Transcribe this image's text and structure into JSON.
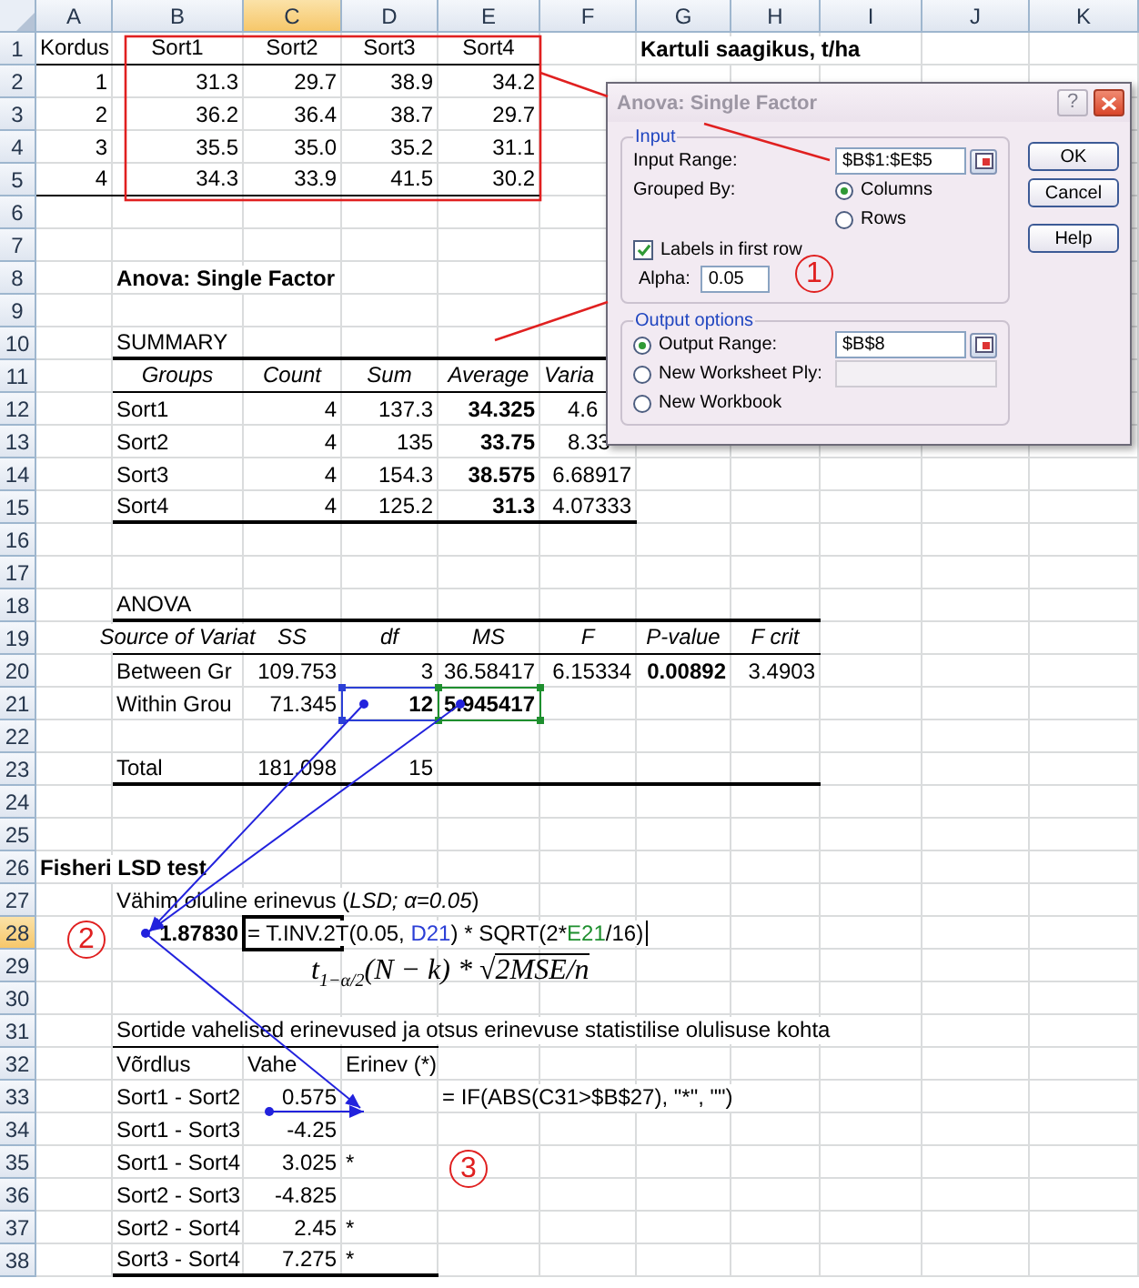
{
  "columns": [
    {
      "label": "A",
      "selected": false
    },
    {
      "label": "B",
      "selected": false
    },
    {
      "label": "C",
      "selected": true
    },
    {
      "label": "D",
      "selected": false
    },
    {
      "label": "E",
      "selected": false
    },
    {
      "label": "F",
      "selected": false
    },
    {
      "label": "G",
      "selected": false
    },
    {
      "label": "H",
      "selected": false
    },
    {
      "label": "I",
      "selected": false
    },
    {
      "label": "J",
      "selected": false
    },
    {
      "label": "K",
      "selected": false
    }
  ],
  "rows": [
    {
      "label": "1",
      "selected": false,
      "cells": {
        "A": {
          "kind": "label",
          "text": "Kordus"
        },
        "B": {
          "kind": "heading_plain",
          "text": "Sort1"
        },
        "C": {
          "kind": "heading_plain",
          "text": "Sort2"
        },
        "D": {
          "kind": "heading_plain",
          "text": "Sort3"
        },
        "E": {
          "kind": "heading_plain",
          "text": "Sort4"
        },
        "G": {
          "kind": "strong",
          "text": "Kartuli saagikus, t/ha"
        }
      }
    },
    {
      "label": "2",
      "selected": false,
      "cells": {
        "A": {
          "kind": "number",
          "text": "1"
        },
        "B": {
          "kind": "number",
          "text": "31.3"
        },
        "C": {
          "kind": "number",
          "text": "29.7"
        },
        "D": {
          "kind": "number",
          "text": "38.9"
        },
        "E": {
          "kind": "number",
          "text": "34.2"
        }
      }
    },
    {
      "label": "3",
      "selected": false,
      "cells": {
        "A": {
          "kind": "number",
          "text": "2"
        },
        "B": {
          "kind": "number",
          "text": "36.2"
        },
        "C": {
          "kind": "number",
          "text": "36.4"
        },
        "D": {
          "kind": "number",
          "text": "38.7"
        },
        "E": {
          "kind": "number",
          "text": "29.7"
        }
      }
    },
    {
      "label": "4",
      "selected": false,
      "cells": {
        "A": {
          "kind": "number",
          "text": "3"
        },
        "B": {
          "kind": "number",
          "text": "35.5"
        },
        "C": {
          "kind": "number",
          "text": "35.0"
        },
        "D": {
          "kind": "number",
          "text": "35.2"
        },
        "E": {
          "kind": "number",
          "text": "31.1"
        }
      }
    },
    {
      "label": "5",
      "selected": false,
      "cells": {
        "A": {
          "kind": "number",
          "text": "4"
        },
        "B": {
          "kind": "number",
          "text": "34.3"
        },
        "C": {
          "kind": "number",
          "text": "33.9"
        },
        "D": {
          "kind": "number",
          "text": "41.5"
        },
        "E": {
          "kind": "number",
          "text": "30.2"
        }
      }
    },
    {
      "label": "6",
      "selected": false
    },
    {
      "label": "7",
      "selected": false
    },
    {
      "label": "8",
      "selected": false,
      "cells": {
        "B": {
          "kind": "strong",
          "text": "Anova: Single Factor"
        }
      }
    },
    {
      "label": "9",
      "selected": false
    },
    {
      "label": "10",
      "selected": false,
      "cells": {
        "B": {
          "kind": "label",
          "text": "SUMMARY"
        }
      }
    },
    {
      "label": "11",
      "selected": false,
      "cells": {
        "B": {
          "kind": "heading",
          "text": "Groups"
        },
        "C": {
          "kind": "heading",
          "text": "Count"
        },
        "D": {
          "kind": "heading",
          "text": "Sum"
        },
        "E": {
          "kind": "heading",
          "text": "Average"
        },
        "F": {
          "kind": "cut_heading",
          "text": "Varia"
        }
      }
    },
    {
      "label": "12",
      "selected": false,
      "cells": {
        "B": {
          "kind": "label",
          "text": "Sort1"
        },
        "C": {
          "kind": "number",
          "text": "4"
        },
        "D": {
          "kind": "number",
          "text": "137.3"
        },
        "E": {
          "kind": "strong_number",
          "text": "34.325"
        },
        "F": {
          "kind": "cut_number",
          "text": "4.6"
        }
      }
    },
    {
      "label": "13",
      "selected": false,
      "cells": {
        "B": {
          "kind": "label",
          "text": "Sort2"
        },
        "C": {
          "kind": "number",
          "text": "4"
        },
        "D": {
          "kind": "number",
          "text": "135"
        },
        "E": {
          "kind": "strong_number",
          "text": "33.75"
        },
        "F": {
          "kind": "cut_number",
          "text": "8.33"
        }
      }
    },
    {
      "label": "14",
      "selected": false,
      "cells": {
        "B": {
          "kind": "label",
          "text": "Sort3"
        },
        "C": {
          "kind": "number",
          "text": "4"
        },
        "D": {
          "kind": "number",
          "text": "154.3"
        },
        "E": {
          "kind": "strong_number",
          "text": "38.575"
        },
        "F": {
          "kind": "number",
          "text": "6.68917"
        }
      }
    },
    {
      "label": "15",
      "selected": false,
      "cells": {
        "B": {
          "kind": "label",
          "text": "Sort4"
        },
        "C": {
          "kind": "number",
          "text": "4"
        },
        "D": {
          "kind": "number",
          "text": "125.2"
        },
        "E": {
          "kind": "strong_number",
          "text": "31.3"
        },
        "F": {
          "kind": "number",
          "text": "4.07333"
        }
      }
    },
    {
      "label": "16",
      "selected": false
    },
    {
      "label": "17",
      "selected": false
    },
    {
      "label": "18",
      "selected": false,
      "cells": {
        "B": {
          "kind": "label",
          "text": "ANOVA"
        }
      }
    },
    {
      "label": "19",
      "selected": false,
      "cells": {
        "B": {
          "kind": "heading",
          "text": "Source of Variat"
        },
        "C": {
          "kind": "heading",
          "text": "SS"
        },
        "D": {
          "kind": "heading",
          "text": "df"
        },
        "E": {
          "kind": "heading",
          "text": "MS"
        },
        "F": {
          "kind": "heading",
          "text": "F"
        },
        "G": {
          "kind": "heading",
          "text": "P-value"
        },
        "H": {
          "kind": "heading",
          "text": "F crit"
        }
      }
    },
    {
      "label": "20",
      "selected": false,
      "cells": {
        "B": {
          "kind": "label",
          "text": "Between Gr"
        },
        "C": {
          "kind": "number",
          "text": "109.753"
        },
        "D": {
          "kind": "number",
          "text": "3"
        },
        "E": {
          "kind": "number",
          "text": "36.58417"
        },
        "F": {
          "kind": "number",
          "text": "6.15334"
        },
        "G": {
          "kind": "strong_number",
          "text": "0.00892"
        },
        "H": {
          "kind": "number",
          "text": "3.4903"
        }
      }
    },
    {
      "label": "21",
      "selected": false,
      "cells": {
        "B": {
          "kind": "label",
          "text": "Within Grou"
        },
        "C": {
          "kind": "number",
          "text": "71.345"
        },
        "D": {
          "kind": "strong_number",
          "text": "12"
        },
        "E": {
          "kind": "strong_number",
          "text": "5.945417"
        }
      }
    },
    {
      "label": "22",
      "selected": false
    },
    {
      "label": "23",
      "selected": false,
      "cells": {
        "B": {
          "kind": "label",
          "text": "Total"
        },
        "C": {
          "kind": "number",
          "text": "181.098"
        },
        "D": {
          "kind": "number",
          "text": "15"
        }
      }
    },
    {
      "label": "24",
      "selected": false
    },
    {
      "label": "25",
      "selected": false
    },
    {
      "label": "26",
      "selected": false,
      "cells": {
        "A": {
          "kind": "strong",
          "text": "Fisheri LSD test"
        }
      }
    },
    {
      "label": "27",
      "selected": false,
      "cells": {
        "B": {
          "kind": "label",
          "text": "Vähim oluline erinevus (*LSD; α=0.05*)"
        }
      }
    },
    {
      "label": "28",
      "selected": true,
      "cells": {
        "B": {
          "kind": "strong_number",
          "text": "1.87830"
        },
        "C": {
          "kind": "formula_edit",
          "parts": [
            {
              "text": "= T.INV.2T(0.05, "
            },
            {
              "text": "D21",
              "color": "#2b3fd6"
            },
            {
              "text": ") * SQRT(2*"
            },
            {
              "text": "E21",
              "color": "#1e8f2e"
            },
            {
              "text": "/16)"
            }
          ]
        }
      }
    },
    {
      "label": "29",
      "selected": false,
      "cells": {
        "C": {
          "kind": "math",
          "text": "t$_{1−α/2}$(N − k) * √",
          "radicand": "2MSE/n"
        }
      }
    },
    {
      "label": "30",
      "selected": false
    },
    {
      "label": "31",
      "selected": false,
      "cells": {
        "B": {
          "kind": "label",
          "text": "Sortide vahelised erinevused ja otsus erinevuse statistilise olulisuse kohta"
        }
      }
    },
    {
      "label": "32",
      "selected": false,
      "cells": {
        "B": {
          "kind": "label",
          "text": "Võrdlus"
        },
        "C": {
          "kind": "label",
          "text": "Vahe"
        },
        "D": {
          "kind": "label",
          "text": "Erinev (*)"
        }
      }
    },
    {
      "label": "33",
      "selected": false,
      "cells": {
        "B": {
          "kind": "label",
          "text": "Sort1 - Sort2"
        },
        "C": {
          "kind": "number",
          "text": "0.575"
        },
        "E": {
          "kind": "label",
          "text": "= IF(ABS(C31>$B$27), \"*\", \"\")"
        }
      }
    },
    {
      "label": "34",
      "selected": false,
      "cells": {
        "B": {
          "kind": "label",
          "text": "Sort1 - Sort3"
        },
        "C": {
          "kind": "number",
          "text": "-4.25"
        }
      }
    },
    {
      "label": "35",
      "selected": false,
      "cells": {
        "B": {
          "kind": "label",
          "text": "Sort1 - Sort4"
        },
        "C": {
          "kind": "number",
          "text": "3.025"
        },
        "D": {
          "kind": "label",
          "text": "*"
        }
      }
    },
    {
      "label": "36",
      "selected": false,
      "cells": {
        "B": {
          "kind": "label",
          "text": "Sort2 - Sort3"
        },
        "C": {
          "kind": "number",
          "text": "-4.825"
        }
      }
    },
    {
      "label": "37",
      "selected": false,
      "cells": {
        "B": {
          "kind": "label",
          "text": "Sort2 - Sort4"
        },
        "C": {
          "kind": "number",
          "text": "2.45"
        },
        "D": {
          "kind": "label",
          "text": "*"
        }
      }
    },
    {
      "label": "38",
      "selected": false,
      "cells": {
        "B": {
          "kind": "label",
          "text": "Sort3 - Sort4"
        },
        "C": {
          "kind": "number",
          "text": "7.275"
        },
        "D": {
          "kind": "label",
          "text": "*"
        }
      }
    }
  ],
  "dialog": {
    "title": "Anova: Single Factor",
    "help": "?",
    "input": {
      "title": "Input",
      "range_label": "Input Range:",
      "range_value": "$B$1:$E$5",
      "grouped_label": "Grouped By:",
      "grouping": [
        {
          "label": "Columns",
          "selected": true
        },
        {
          "label": "Rows",
          "selected": false
        }
      ],
      "labels_row": {
        "label": "Labels in first row",
        "checked": true
      },
      "alpha_label": "Alpha:",
      "alpha_value": "0.05"
    },
    "output": {
      "title": "Output options",
      "options": [
        {
          "label": "Output Range:",
          "selected": true,
          "kind": "range",
          "value": "$B$8"
        },
        {
          "label": "New Worksheet Ply:",
          "selected": false,
          "kind": "disabled_field"
        },
        {
          "label": "New Workbook",
          "selected": false,
          "kind": "plain"
        }
      ]
    },
    "buttons": [
      "OK",
      "Cancel",
      "Help"
    ]
  },
  "annotations": [
    {
      "label": "1"
    },
    {
      "label": "2"
    },
    {
      "label": "3"
    }
  ]
}
